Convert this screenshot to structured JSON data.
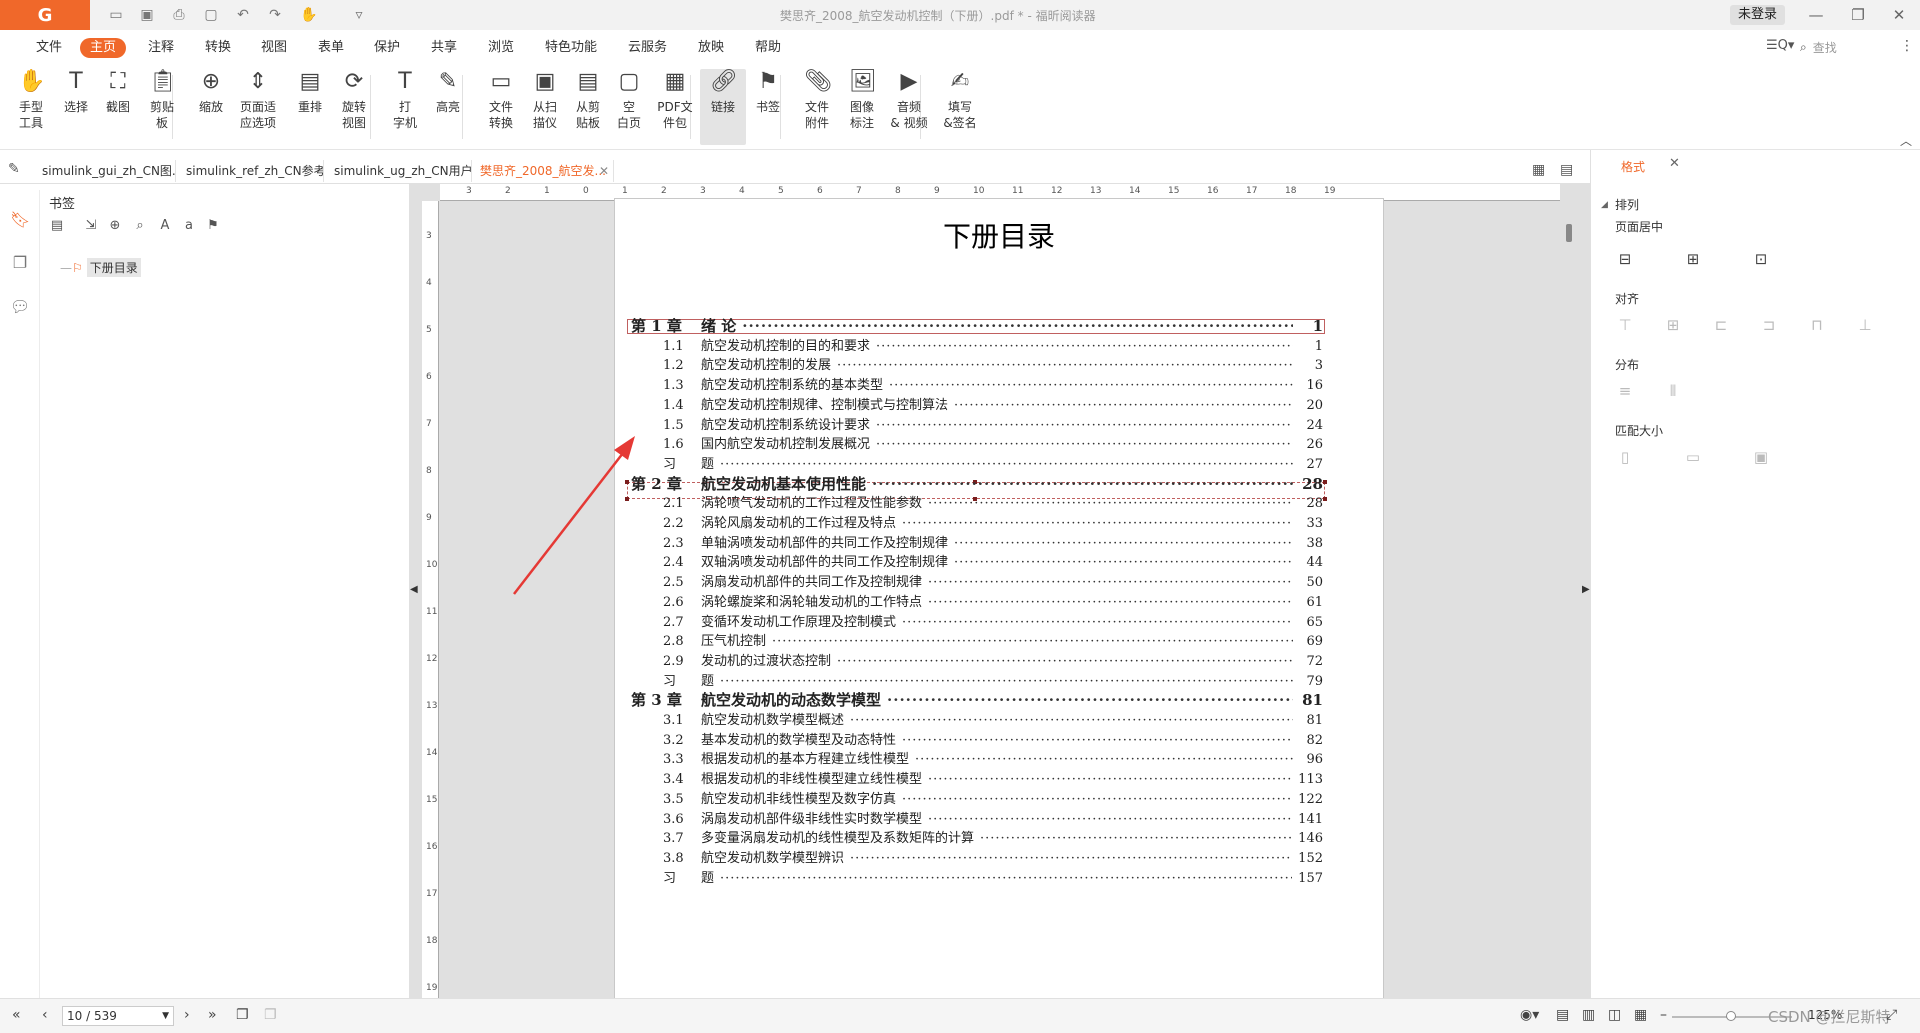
{
  "app": {
    "logo_letter": "G",
    "document_title": "樊思齐_2008_航空发动机控制（下册）.pdf * - 福昕阅读器",
    "login_label": "未登录"
  },
  "menu": {
    "items": [
      "文件",
      "主页",
      "注释",
      "转换",
      "视图",
      "表单",
      "保护",
      "共享",
      "浏览",
      "特色功能",
      "云服务",
      "放映",
      "帮助"
    ],
    "active": "主页",
    "search_placeholder": "查找"
  },
  "ribbon": {
    "buttons": [
      {
        "label": "手型\n工具",
        "icon": "hand-icon"
      },
      {
        "label": "选择",
        "icon": "select-text-icon"
      },
      {
        "label": "截图",
        "icon": "screenshot-icon"
      },
      {
        "label": "剪贴\n板",
        "icon": "clipboard-icon"
      },
      {
        "label": "缩放",
        "icon": "zoom-icon"
      },
      {
        "label": "页面适\n应选项",
        "icon": "fit-page-icon"
      },
      {
        "label": "重排",
        "icon": "reflow-icon"
      },
      {
        "label": "旋转\n视图",
        "icon": "rotate-view-icon"
      },
      {
        "label": "打\n字机",
        "icon": "typewriter-icon"
      },
      {
        "label": "高亮",
        "icon": "highlight-icon"
      },
      {
        "label": "文件\n转换",
        "icon": "file-convert-icon"
      },
      {
        "label": "从扫\n描仪",
        "icon": "scanner-icon"
      },
      {
        "label": "从剪\n贴板",
        "icon": "from-clipboard-icon"
      },
      {
        "label": "空\n白页",
        "icon": "blank-page-icon"
      },
      {
        "label": "PDF文\n件包",
        "icon": "pdf-package-icon"
      },
      {
        "label": "链接",
        "icon": "link-icon"
      },
      {
        "label": "书签",
        "icon": "bookmark-icon"
      },
      {
        "label": "文件\n附件",
        "icon": "attachment-icon"
      },
      {
        "label": "图像\n标注",
        "icon": "image-annotation-icon"
      },
      {
        "label": "音频\n& 视频",
        "icon": "audio-video-icon"
      },
      {
        "label": "填写\n&签名",
        "icon": "fill-sign-icon"
      }
    ],
    "selected": "链接"
  },
  "tabs": [
    {
      "label": "simulink_gui_zh_CN图..."
    },
    {
      "label": "simulink_ref_zh_CN参考..."
    },
    {
      "label": "simulink_ug_zh_CN用户..."
    },
    {
      "label": "樊思齐_2008_航空发..."
    }
  ],
  "bookmarks": {
    "title": "书签",
    "items": [
      "下册目录"
    ]
  },
  "ruler": {
    "top_ticks": [
      "3",
      "2",
      "1",
      "0",
      "1",
      "2",
      "3",
      "4",
      "5",
      "6",
      "7",
      "8",
      "9",
      "10",
      "11",
      "12",
      "13",
      "14",
      "15",
      "16",
      "17",
      "18",
      "19"
    ],
    "left_ticks": [
      "3",
      "4",
      "5",
      "6",
      "7",
      "8",
      "9",
      "10",
      "11",
      "12",
      "13",
      "14",
      "15",
      "16",
      "17",
      "18",
      "19"
    ]
  },
  "toc": {
    "title": "下册目录",
    "entries": [
      {
        "level": "ch",
        "num": "第 1 章",
        "text": "绪  论",
        "page": "1"
      },
      {
        "level": "sec",
        "num": "1.1",
        "text": "航空发动机控制的目的和要求",
        "page": "1"
      },
      {
        "level": "sec",
        "num": "1.2",
        "text": "航空发动机控制的发展",
        "page": "3"
      },
      {
        "level": "sec",
        "num": "1.3",
        "text": "航空发动机控制系统的基本类型",
        "page": "16"
      },
      {
        "level": "sec",
        "num": "1.4",
        "text": "航空发动机控制规律、控制模式与控制算法",
        "page": "20"
      },
      {
        "level": "sec",
        "num": "1.5",
        "text": "航空发动机控制系统设计要求",
        "page": "24"
      },
      {
        "level": "sec",
        "num": "1.6",
        "text": "国内航空发动机控制发展概况",
        "page": "26"
      },
      {
        "level": "sec",
        "num": "习",
        "text": "题",
        "page": "27"
      },
      {
        "level": "ch",
        "num": "第 2 章",
        "text": "航空发动机基本使用性能",
        "page": "28"
      },
      {
        "level": "sec",
        "num": "2.1",
        "text": "涡轮喷气发动机的工作过程及性能参数",
        "page": "28"
      },
      {
        "level": "sec",
        "num": "2.2",
        "text": "涡轮风扇发动机的工作过程及特点",
        "page": "33"
      },
      {
        "level": "sec",
        "num": "2.3",
        "text": "单轴涡喷发动机部件的共同工作及控制规律",
        "page": "38"
      },
      {
        "level": "sec",
        "num": "2.4",
        "text": "双轴涡喷发动机部件的共同工作及控制规律",
        "page": "44"
      },
      {
        "level": "sec",
        "num": "2.5",
        "text": "涡扇发动机部件的共同工作及控制规律",
        "page": "50"
      },
      {
        "level": "sec",
        "num": "2.6",
        "text": "涡轮螺旋桨和涡轮轴发动机的工作特点",
        "page": "61"
      },
      {
        "level": "sec",
        "num": "2.7",
        "text": "变循环发动机工作原理及控制模式",
        "page": "65"
      },
      {
        "level": "sec",
        "num": "2.8",
        "text": "压气机控制",
        "page": "69"
      },
      {
        "level": "sec",
        "num": "2.9",
        "text": "发动机的过渡状态控制",
        "page": "72"
      },
      {
        "level": "sec",
        "num": "习",
        "text": "题",
        "page": "79"
      },
      {
        "level": "ch",
        "num": "第 3 章",
        "text": "航空发动机的动态数学模型",
        "page": "81"
      },
      {
        "level": "sec",
        "num": "3.1",
        "text": "航空发动机数学模型概述",
        "page": "81"
      },
      {
        "level": "sec",
        "num": "3.2",
        "text": "基本发动机的数学模型及动态特性",
        "page": "82"
      },
      {
        "level": "sec",
        "num": "3.3",
        "text": "根据发动机的基本方程建立线性模型",
        "page": "96"
      },
      {
        "level": "sec",
        "num": "3.4",
        "text": "根据发动机的非线性模型建立线性模型",
        "page": "113"
      },
      {
        "level": "sec",
        "num": "3.5",
        "text": "航空发动机非线性模型及数字仿真",
        "page": "122"
      },
      {
        "level": "sec",
        "num": "3.6",
        "text": "涡扇发动机部件级非线性实时数学模型",
        "page": "141"
      },
      {
        "level": "sec",
        "num": "3.7",
        "text": "多变量涡扇发动机的线性模型及系数矩阵的计算",
        "page": "146"
      },
      {
        "level": "sec",
        "num": "3.8",
        "text": "航空发动机数学模型辨识",
        "page": "152"
      },
      {
        "level": "sec",
        "num": "习",
        "text": "题",
        "page": "157"
      }
    ]
  },
  "format_panel": {
    "tab_label": "格式",
    "section_arrange": "排列",
    "section_center": "页面居中",
    "section_align": "对齐",
    "section_distribute": "分布",
    "section_match": "匹配大小"
  },
  "status": {
    "page_indicator": "10 / 539",
    "zoom": "125%",
    "watermark": "CSDN @拦尼斯特"
  },
  "colors": {
    "accent": "#f0682a",
    "selection_border": "#c06060",
    "arrow": "#e53935"
  }
}
